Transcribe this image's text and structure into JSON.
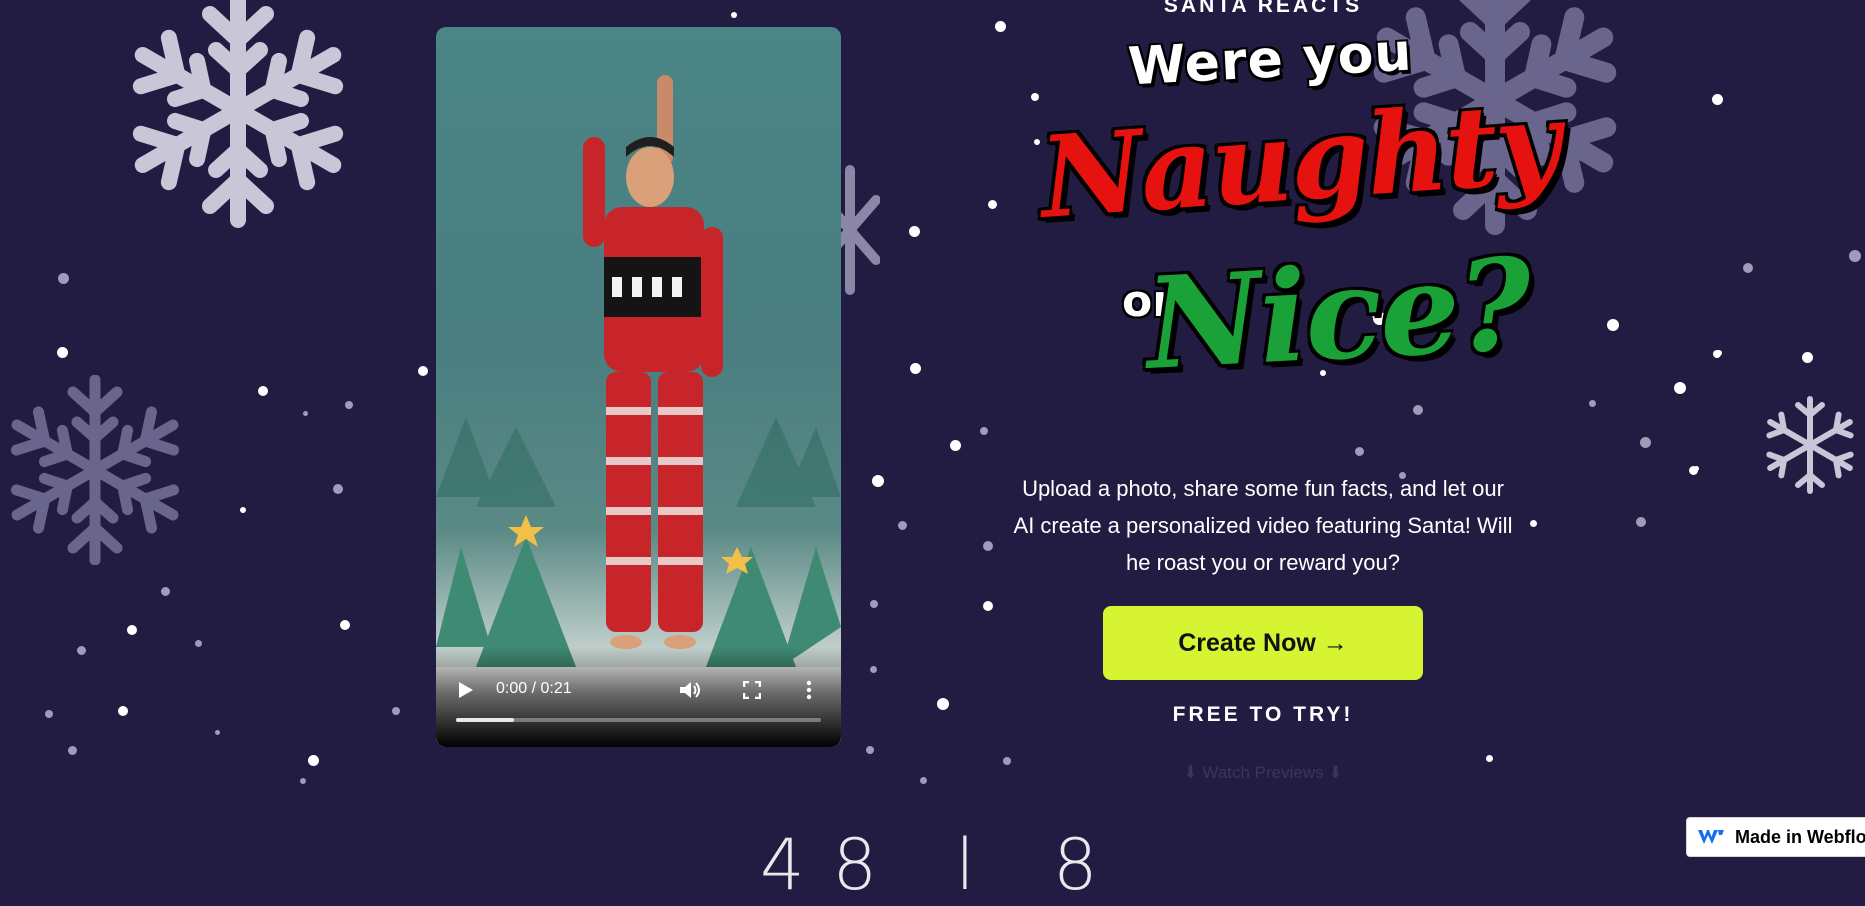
{
  "hero": {
    "eyebrow": "SANTA REACTS",
    "title_line1": "Were you",
    "title_naughty": "Naughty",
    "title_or": "or",
    "title_nice": "Nice?",
    "description": "Upload a photo, share some fun facts, and let our AI create a personalized video featuring Santa! Will he roast you or reward you?",
    "cta_label": "Create Now →",
    "free_label": "FREE TO TRY!",
    "previews_link": "⬇ Watch Previews ⬇"
  },
  "video": {
    "time_display": "0:00 / 0:21",
    "progress_percent": 16,
    "controls": {
      "play_icon": "play-icon",
      "volume_icon": "volume-icon",
      "fullscreen_icon": "fullscreen-icon",
      "more_icon": "more-options-icon"
    }
  },
  "footer_badge": {
    "label": "Made in Webflow"
  },
  "bottom_partial_text": "48 l 8",
  "colors": {
    "background": "#221c42",
    "cta": "#d6f432",
    "naughty": "#e5120f",
    "nice": "#1aa238"
  }
}
